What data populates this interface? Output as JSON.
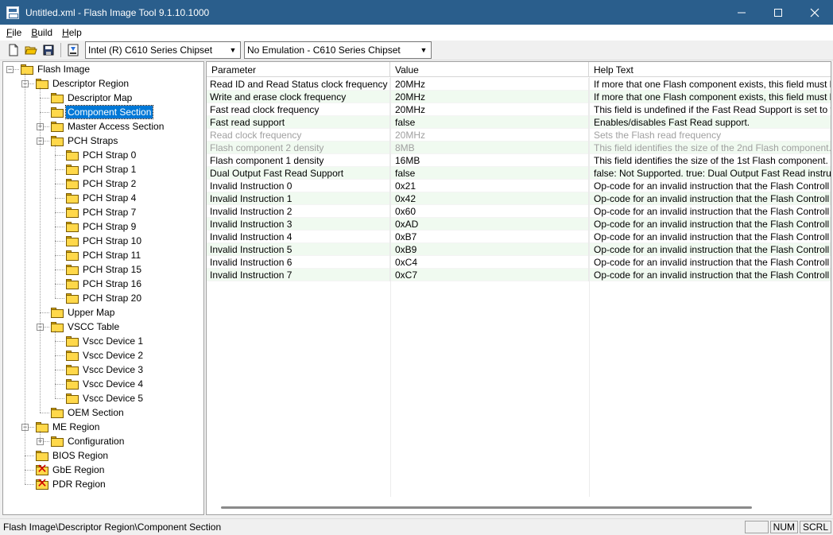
{
  "window": {
    "title": "Untitled.xml - Flash Image Tool 9.1.10.1000",
    "minimize_icon": "minimize-icon",
    "maximize_icon": "maximize-icon",
    "close_icon": "close-icon"
  },
  "menu": [
    "File",
    "Build",
    "Help"
  ],
  "toolbar": {
    "chipset": "Intel (R) C610 Series Chipset",
    "emulation": "No Emulation - C610 Series Chipset"
  },
  "tree": [
    {
      "label": "Flash Image",
      "level": 0,
      "expander": "-"
    },
    {
      "label": "Descriptor Region",
      "level": 1,
      "expander": "-"
    },
    {
      "label": "Descriptor Map",
      "level": 2
    },
    {
      "label": "Component Section",
      "level": 2,
      "selected": true
    },
    {
      "label": "Master Access Section",
      "level": 2,
      "expander": "+"
    },
    {
      "label": "PCH Straps",
      "level": 2,
      "expander": "-"
    },
    {
      "label": "PCH Strap 0",
      "level": 3
    },
    {
      "label": "PCH Strap 1",
      "level": 3
    },
    {
      "label": "PCH Strap 2",
      "level": 3
    },
    {
      "label": "PCH Strap 4",
      "level": 3
    },
    {
      "label": "PCH Strap 7",
      "level": 3
    },
    {
      "label": "PCH Strap 9",
      "level": 3
    },
    {
      "label": "PCH Strap 10",
      "level": 3
    },
    {
      "label": "PCH Strap 11",
      "level": 3
    },
    {
      "label": "PCH Strap 15",
      "level": 3
    },
    {
      "label": "PCH Strap 16",
      "level": 3
    },
    {
      "label": "PCH Strap 20",
      "level": 3
    },
    {
      "label": "Upper Map",
      "level": 2
    },
    {
      "label": "VSCC Table",
      "level": 2,
      "expander": "-"
    },
    {
      "label": "Vscc Device 1",
      "level": 3
    },
    {
      "label": "Vscc Device 2",
      "level": 3
    },
    {
      "label": "Vscc Device 3",
      "level": 3
    },
    {
      "label": "Vscc Device 4",
      "level": 3
    },
    {
      "label": "Vscc Device 5",
      "level": 3
    },
    {
      "label": "OEM Section",
      "level": 2
    },
    {
      "label": "ME Region",
      "level": 1,
      "expander": "-"
    },
    {
      "label": "Configuration",
      "level": 2,
      "expander": "+"
    },
    {
      "label": "BIOS Region",
      "level": 1
    },
    {
      "label": "GbE Region",
      "level": 1,
      "disabled_icon": true
    },
    {
      "label": "PDR Region",
      "level": 1,
      "disabled_icon": true
    }
  ],
  "grid": {
    "headers": [
      "Parameter",
      "Value",
      "Help Text"
    ],
    "rows": [
      {
        "param": "Read ID and Read Status clock frequency",
        "value": "20MHz",
        "help": "If more that one Flash component exists, this field must b"
      },
      {
        "param": "Write and erase clock frequency",
        "value": "20MHz",
        "help": "If more that one Flash component exists, this field must b"
      },
      {
        "param": "Fast read clock frequency",
        "value": "20MHz",
        "help": "This field is undefined if the Fast Read Support is set to fa"
      },
      {
        "param": "Fast read support",
        "value": "false",
        "help": "Enables/disables Fast Read support."
      },
      {
        "param": "Read clock frequency",
        "value": "20MHz",
        "help": "Sets the Flash read frequency",
        "disabled": true
      },
      {
        "param": "Flash component 2 density",
        "value": "8MB",
        "help": "This field identifies the size of the 2nd Flash component.",
        "disabled": true
      },
      {
        "param": "Flash component 1 density",
        "value": "16MB",
        "help": "This field identifies the size of the 1st Flash component."
      },
      {
        "param": "Dual Output Fast Read Support",
        "value": "false",
        "help": "false: Not Supported. true: Dual Output Fast Read instruct"
      },
      {
        "param": "Invalid Instruction 0",
        "value": "0x21",
        "help": "Op-code for an invalid instruction that the Flash Controll"
      },
      {
        "param": "Invalid Instruction 1",
        "value": "0x42",
        "help": "Op-code for an invalid instruction that the Flash Controll"
      },
      {
        "param": "Invalid Instruction 2",
        "value": "0x60",
        "help": "Op-code for an invalid instruction that the Flash Controll"
      },
      {
        "param": "Invalid Instruction 3",
        "value": "0xAD",
        "help": "Op-code for an invalid instruction that the Flash Controll"
      },
      {
        "param": "Invalid Instruction 4",
        "value": "0xB7",
        "help": "Op-code for an invalid instruction that the Flash Controll"
      },
      {
        "param": "Invalid Instruction 5",
        "value": "0xB9",
        "help": "Op-code for an invalid instruction that the Flash Controll"
      },
      {
        "param": "Invalid Instruction 6",
        "value": "0xC4",
        "help": "Op-code for an invalid instruction that the Flash Controll"
      },
      {
        "param": "Invalid Instruction 7",
        "value": "0xC7",
        "help": "Op-code for an invalid instruction that the Flash Controll"
      }
    ]
  },
  "status": {
    "path": "Flash Image\\Descriptor Region\\Component Section",
    "caps": "",
    "num": "NUM",
    "scrl": "SCRL"
  }
}
